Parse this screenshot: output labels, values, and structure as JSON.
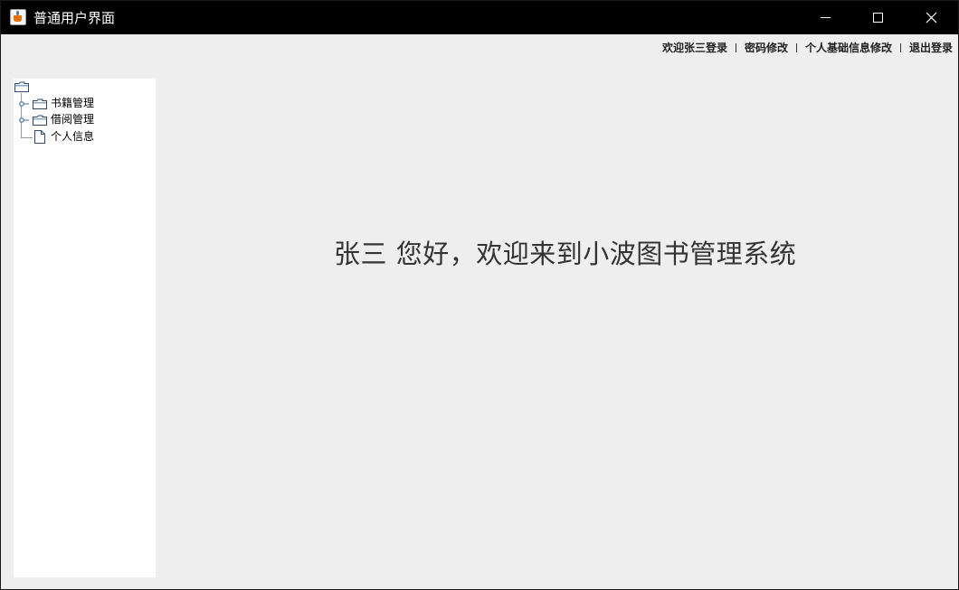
{
  "window": {
    "title": "普通用户界面"
  },
  "toplinks": {
    "welcome": "欢迎张三登录",
    "change_password": "密码修改",
    "edit_profile": "个人基础信息修改",
    "logout": "退出登录"
  },
  "tree": {
    "root_label": "",
    "items": [
      {
        "label": "书籍管理",
        "icon": "folder-icon",
        "expandable": true
      },
      {
        "label": "借阅管理",
        "icon": "folder-icon",
        "expandable": true
      },
      {
        "label": "个人信息",
        "icon": "file-icon",
        "expandable": false
      }
    ]
  },
  "main": {
    "welcome_message": "张三  您好，欢迎来到小波图书管理系统"
  }
}
